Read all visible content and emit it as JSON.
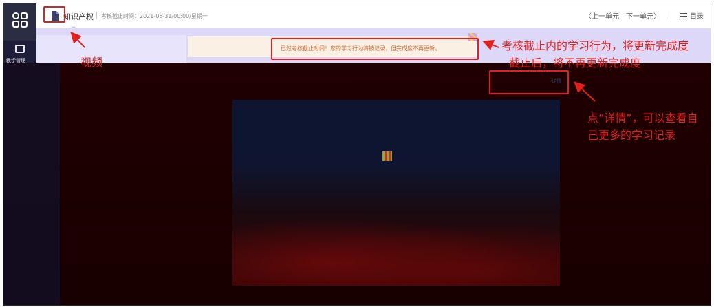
{
  "header": {
    "course_name": "知识产权",
    "deadline": "考核截止时间：2021-05-31/00:00/星期一",
    "prev_label": "〈上一单元",
    "next_label": "下一单元〉",
    "menu_label": "目录"
  },
  "left_nav": {
    "item_label": "教学管理"
  },
  "notice": {
    "text": "已过考核截止时间！您的学习行为将被记录，但完成度不再更新。"
  },
  "content": {
    "details_label": "详情"
  },
  "annotations": {
    "video": "视频",
    "deadline_line1": "考核截止内的学习行为，将更新完成度",
    "deadline_line2": "截止后，将不再更新完成度",
    "details_line1": "点“详情”，可以查看自",
    "details_line2": "己更多的学习记录",
    "color": "#e0201c"
  },
  "icons": {
    "logo": "app-grid-logo-icon",
    "course": "document-icon",
    "menu": "list-menu-icon",
    "nav": "teaching-management-icon"
  }
}
